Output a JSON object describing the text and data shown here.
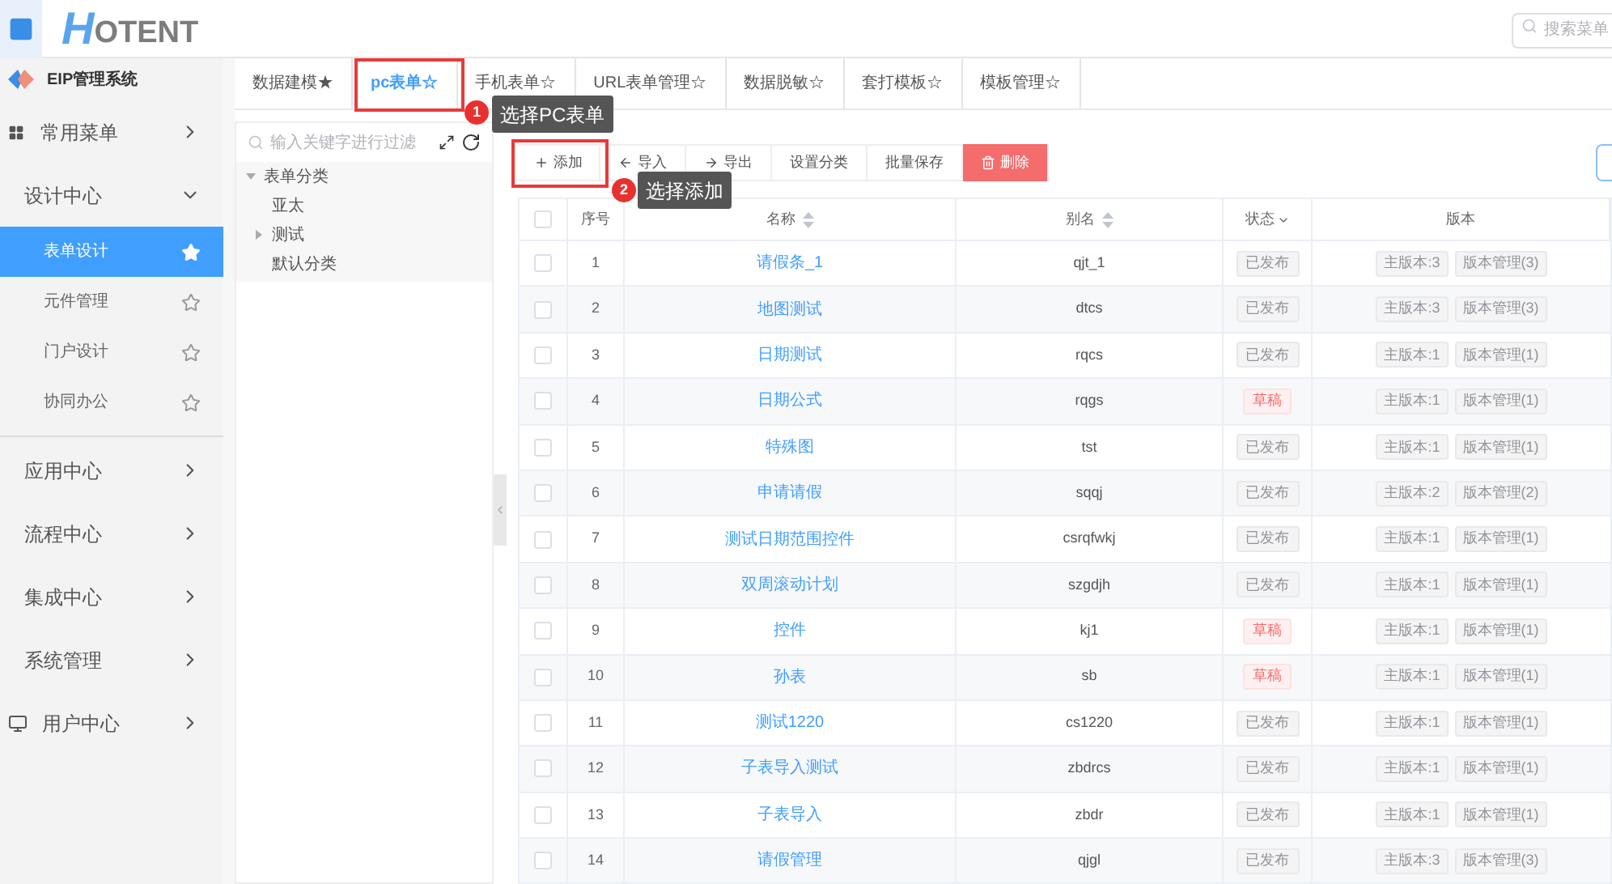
{
  "header": {
    "logo": {
      "mark": "H",
      "text": "OTENT"
    },
    "search": {
      "placeholder": "搜索菜单"
    }
  },
  "sidebar": {
    "title": "EIP管理系统",
    "items": [
      {
        "label": "常用菜单",
        "expanded": false
      },
      {
        "label": "设计中心",
        "expanded": true,
        "children": [
          {
            "label": "表单设计",
            "selected": true,
            "starred": true
          },
          {
            "label": "元件管理",
            "selected": false,
            "starred": false
          },
          {
            "label": "门户设计",
            "selected": false,
            "starred": false
          },
          {
            "label": "协同办公",
            "selected": false,
            "starred": false
          }
        ]
      },
      {
        "label": "应用中心",
        "expanded": false
      },
      {
        "label": "流程中心",
        "expanded": false
      },
      {
        "label": "集成中心",
        "expanded": false
      },
      {
        "label": "系统管理",
        "expanded": false
      },
      {
        "label": "用户中心",
        "expanded": false
      }
    ]
  },
  "tabs": [
    {
      "label": "数据建模★",
      "selected": false
    },
    {
      "label": "pc表单☆",
      "selected": true
    },
    {
      "label": "手机表单☆",
      "selected": false
    },
    {
      "label": "URL表单管理☆",
      "selected": false
    },
    {
      "label": "数据脱敏☆",
      "selected": false
    },
    {
      "label": "套打模板☆",
      "selected": false
    },
    {
      "label": "模板管理☆",
      "selected": false
    }
  ],
  "tree": {
    "search": {
      "placeholder": "输入关键字进行过滤"
    },
    "nodes": [
      {
        "label": "表单分类",
        "expanded": true,
        "children": [
          {
            "label": "亚太"
          },
          {
            "label": "测试",
            "expanded": false
          },
          {
            "label": "默认分类"
          }
        ]
      }
    ]
  },
  "toolbar": [
    {
      "kind": "add",
      "label": "添加"
    },
    {
      "kind": "import",
      "label": "导入"
    },
    {
      "kind": "export",
      "label": "导出"
    },
    {
      "kind": "plain",
      "label": "设置分类"
    },
    {
      "kind": "plain",
      "label": "批量保存"
    },
    {
      "kind": "danger",
      "label": "删除"
    }
  ],
  "table": {
    "columns": [
      {
        "kind": "checkbox",
        "checked": false
      },
      {
        "kind": "plain",
        "label": "序号"
      },
      {
        "kind": "sort",
        "label": "名称"
      },
      {
        "kind": "sort",
        "label": "别名"
      },
      {
        "kind": "filter",
        "label": "状态"
      },
      {
        "kind": "plain",
        "label": "版本"
      }
    ],
    "rows": [
      {
        "checked": false,
        "no": "1",
        "name": "请假条_1",
        "alias": "qjt_1",
        "status": {
          "kind": "published",
          "label": "已发布"
        },
        "main": "主版本:3",
        "manage": "版本管理(3)"
      },
      {
        "checked": false,
        "no": "2",
        "name": "地图测试",
        "alias": "dtcs",
        "status": {
          "kind": "published",
          "label": "已发布"
        },
        "main": "主版本:3",
        "manage": "版本管理(3)"
      },
      {
        "checked": false,
        "no": "3",
        "name": "日期测试",
        "alias": "rqcs",
        "status": {
          "kind": "published",
          "label": "已发布"
        },
        "main": "主版本:1",
        "manage": "版本管理(1)"
      },
      {
        "checked": false,
        "no": "4",
        "name": "日期公式",
        "alias": "rqgs",
        "status": {
          "kind": "draft",
          "label": "草稿"
        },
        "main": "主版本:1",
        "manage": "版本管理(1)"
      },
      {
        "checked": false,
        "no": "5",
        "name": "特殊图",
        "alias": "tst",
        "status": {
          "kind": "published",
          "label": "已发布"
        },
        "main": "主版本:1",
        "manage": "版本管理(1)"
      },
      {
        "checked": false,
        "no": "6",
        "name": "申请请假",
        "alias": "sqqj",
        "status": {
          "kind": "published",
          "label": "已发布"
        },
        "main": "主版本:2",
        "manage": "版本管理(2)"
      },
      {
        "checked": false,
        "no": "7",
        "name": "测试日期范围控件",
        "alias": "csrqfwkj",
        "status": {
          "kind": "published",
          "label": "已发布"
        },
        "main": "主版本:1",
        "manage": "版本管理(1)"
      },
      {
        "checked": false,
        "no": "8",
        "name": "双周滚动计划",
        "alias": "szgdjh",
        "status": {
          "kind": "published",
          "label": "已发布"
        },
        "main": "主版本:1",
        "manage": "版本管理(1)"
      },
      {
        "checked": false,
        "no": "9",
        "name": "控件",
        "alias": "kj1",
        "status": {
          "kind": "draft",
          "label": "草稿"
        },
        "main": "主版本:1",
        "manage": "版本管理(1)"
      },
      {
        "checked": false,
        "no": "10",
        "name": "孙表",
        "alias": "sb",
        "status": {
          "kind": "draft",
          "label": "草稿"
        },
        "main": "主版本:1",
        "manage": "版本管理(1)"
      },
      {
        "checked": false,
        "no": "11",
        "name": "测试1220",
        "alias": "cs1220",
        "status": {
          "kind": "published",
          "label": "已发布"
        },
        "main": "主版本:1",
        "manage": "版本管理(1)"
      },
      {
        "checked": false,
        "no": "12",
        "name": "子表导入测试",
        "alias": "zbdrcs",
        "status": {
          "kind": "published",
          "label": "已发布"
        },
        "main": "主版本:1",
        "manage": "版本管理(1)"
      },
      {
        "checked": false,
        "no": "13",
        "name": "子表导入",
        "alias": "zbdr",
        "status": {
          "kind": "published",
          "label": "已发布"
        },
        "main": "主版本:1",
        "manage": "版本管理(1)"
      },
      {
        "checked": false,
        "no": "14",
        "name": "请假管理",
        "alias": "qjgl",
        "status": {
          "kind": "published",
          "label": "已发布"
        },
        "main": "主版本:3",
        "manage": "版本管理(3)"
      }
    ]
  },
  "annotations": [
    {
      "number": "1",
      "text": "选择PC表单"
    },
    {
      "number": "2",
      "text": "选择添加"
    }
  ]
}
